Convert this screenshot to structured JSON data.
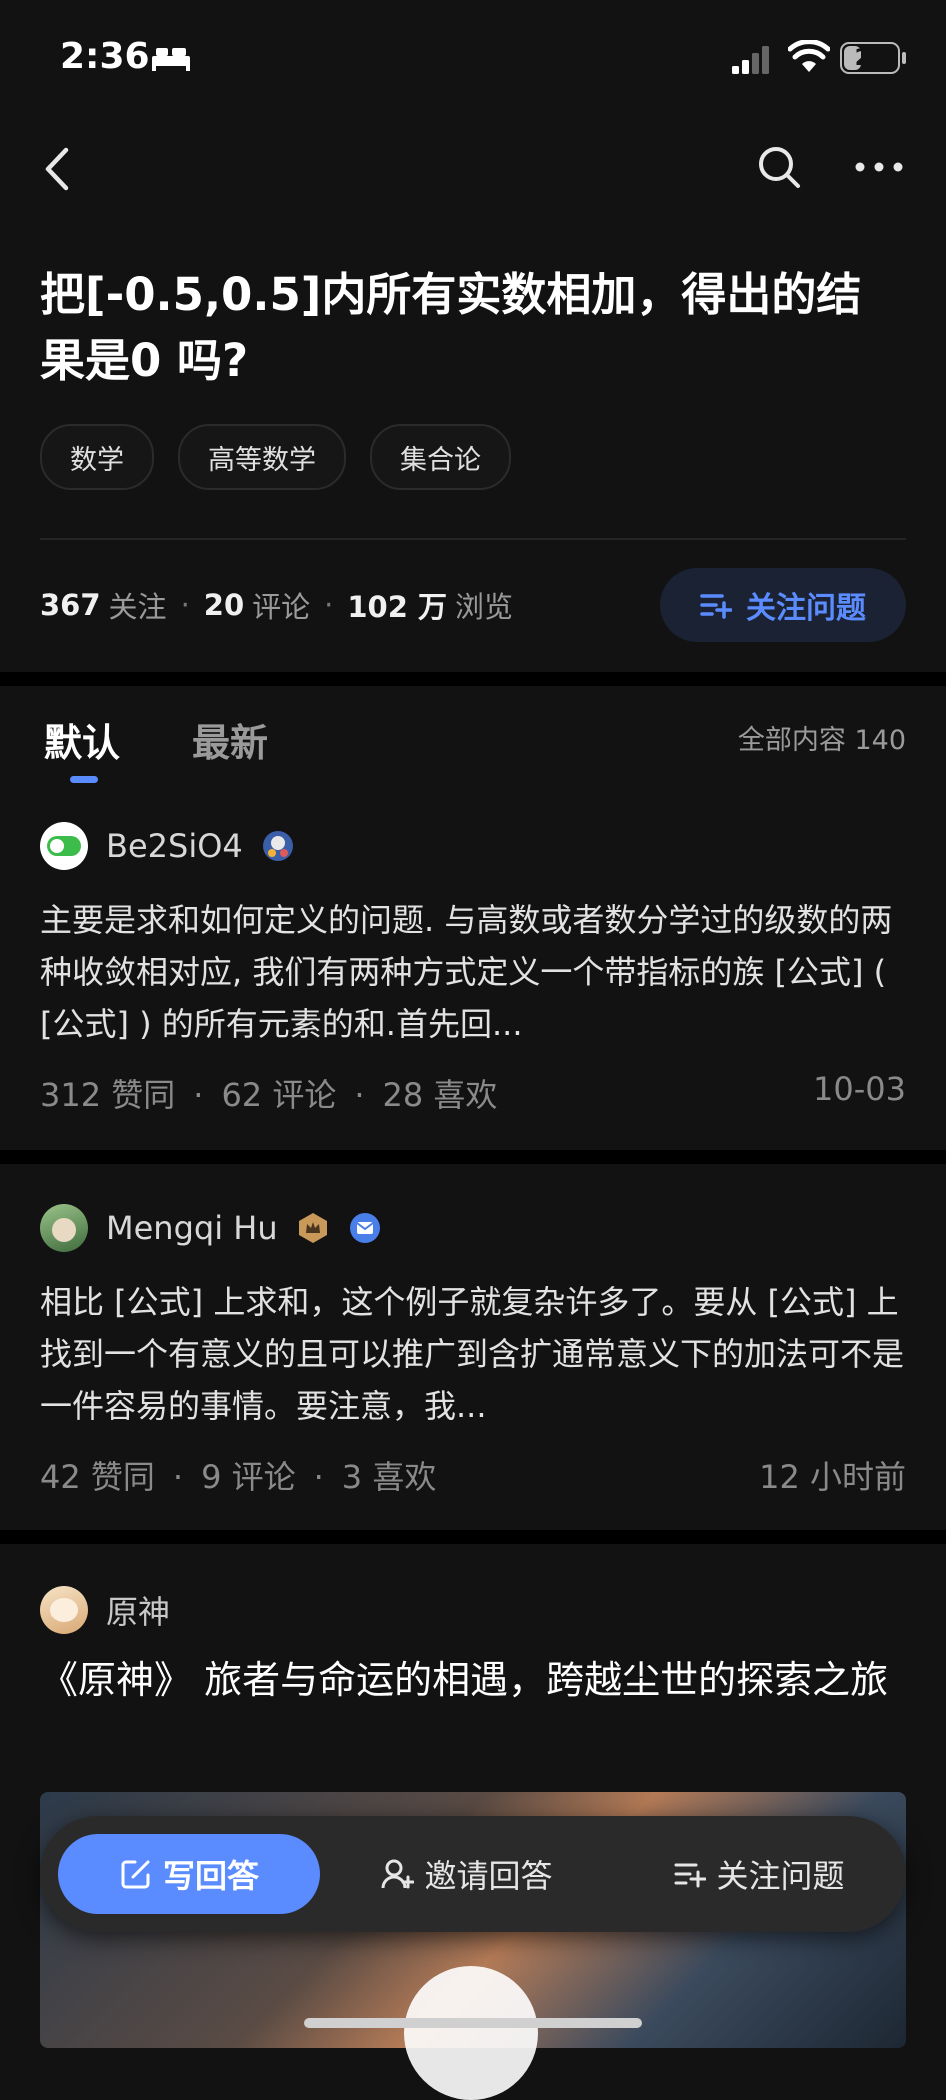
{
  "status_bar": {
    "time": "2:36",
    "battery": "22"
  },
  "question": {
    "title": "把[-0.5,0.5]内所有实数相加，得出的结果是0 吗?",
    "tags": [
      "数学",
      "高等数学",
      "集合论"
    ],
    "follow_count": "367",
    "follow_label": "关注",
    "comment_count": "20",
    "comment_label": "评论",
    "view_count": "102 万",
    "view_label": "浏览",
    "follow_button": "关注问题"
  },
  "tabs": {
    "default": "默认",
    "latest": "最新",
    "all_content": "全部内容 140"
  },
  "answers": [
    {
      "author": "Be2SiO4",
      "excerpt": "主要是求和如何定义的问题. 与高数或者数分学过的级数的两种收敛相对应, 我们有两种方式定义一个带指标的族 [公式] ( [公式] ) 的所有元素的和.首先回...",
      "likes": "312 赞同",
      "comments": "62 评论",
      "favorites": "28 喜欢",
      "time": "10-03"
    },
    {
      "author": "Mengqi Hu",
      "excerpt": "相比 [公式] 上求和，这个例子就复杂许多了。要从 [公式] 上找到一个有意义的且可以推广到含扩通常意义下的加法可不是一件容易的事情。要注意，我...",
      "likes": "42 赞同",
      "comments": "9 评论",
      "favorites": "3 喜欢",
      "time": "12 小时前"
    }
  ],
  "ad": {
    "author": "原神",
    "title": "《原神》 旅者与命运的相遇，跨越尘世的探索之旅"
  },
  "bottom_bar": {
    "write": "写回答",
    "invite": "邀请回答",
    "follow": "关注问题"
  },
  "colors": {
    "accent": "#5b8cff",
    "background": "#121212"
  }
}
